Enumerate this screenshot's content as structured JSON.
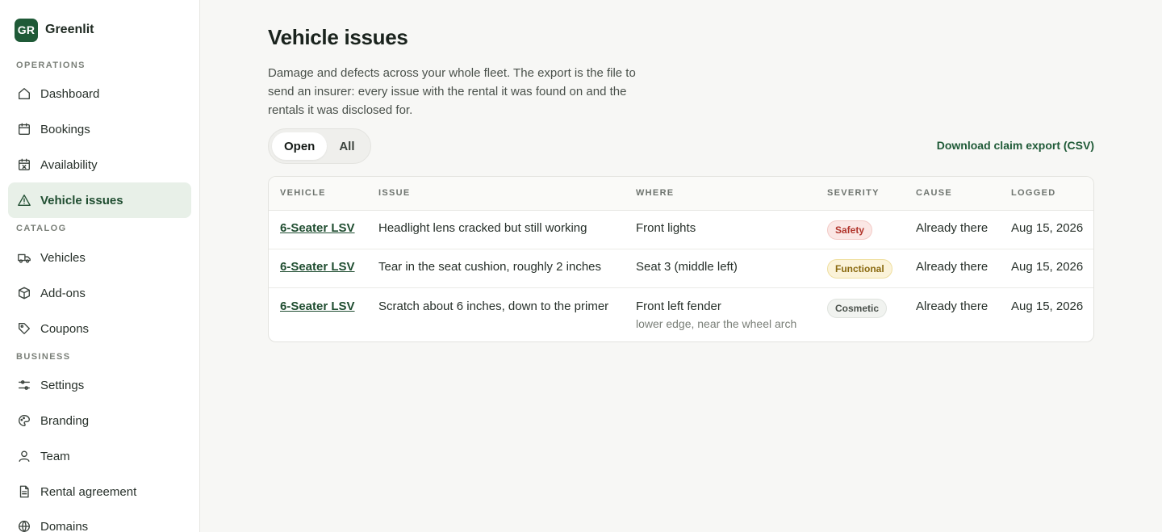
{
  "brand": {
    "initials": "GR",
    "name": "Greenlit"
  },
  "sidebar": {
    "sections": {
      "operations": "OPERATIONS",
      "catalog": "CATALOG",
      "business": "BUSINESS"
    },
    "items": [
      {
        "label": "Dashboard",
        "icon": "home-icon"
      },
      {
        "label": "Bookings",
        "icon": "calendar-icon"
      },
      {
        "label": "Availability",
        "icon": "calendar-x-icon"
      },
      {
        "label": "Vehicle issues",
        "icon": "warning-icon",
        "active": true
      },
      {
        "label": "Vehicles",
        "icon": "truck-icon"
      },
      {
        "label": "Add-ons",
        "icon": "box-icon"
      },
      {
        "label": "Coupons",
        "icon": "tag-icon"
      },
      {
        "label": "Settings",
        "icon": "sliders-icon"
      },
      {
        "label": "Branding",
        "icon": "palette-icon"
      },
      {
        "label": "Team",
        "icon": "user-icon"
      },
      {
        "label": "Rental agreement",
        "icon": "document-icon"
      },
      {
        "label": "Domains",
        "icon": "globe-icon"
      }
    ]
  },
  "main": {
    "title": "Vehicle issues",
    "description": "Damage and defects across your whole fleet. The export is the file to send an insurer: every issue with the rental it was found on and the rentals it was disclosed for.",
    "tabs": [
      {
        "label": "Open",
        "active": true
      },
      {
        "label": "All",
        "active": false
      }
    ],
    "export_label": "Download claim export (CSV)",
    "table": {
      "headers": [
        "VEHICLE",
        "ISSUE",
        "WHERE",
        "SEVERITY",
        "CAUSE",
        "LOGGED"
      ],
      "rows": [
        {
          "vehicle": "6-Seater LSV",
          "issue": "Headlight lens cracked but still working",
          "where": "Front lights",
          "where_detail": "",
          "severity": "Safety",
          "cause": "Already there",
          "logged": "Aug 15, 2026"
        },
        {
          "vehicle": "6-Seater LSV",
          "issue": "Tear in the seat cushion, roughly 2 inches",
          "where": "Seat 3 (middle left)",
          "where_detail": "",
          "severity": "Functional",
          "cause": "Already there",
          "logged": "Aug 15, 2026"
        },
        {
          "vehicle": "6-Seater LSV",
          "issue": "Scratch about 6 inches, down to the primer",
          "where": "Front left fender",
          "where_detail": "lower edge, near the wheel arch",
          "severity": "Cosmetic",
          "cause": "Already there",
          "logged": "Aug 15, 2026"
        }
      ]
    }
  },
  "colors": {
    "accent": "#1f5a37",
    "active_nav_bg": "#e8f0e8",
    "safety": "#b1352c",
    "functional": "#8a6a10",
    "cosmetic": "#4a514b"
  }
}
